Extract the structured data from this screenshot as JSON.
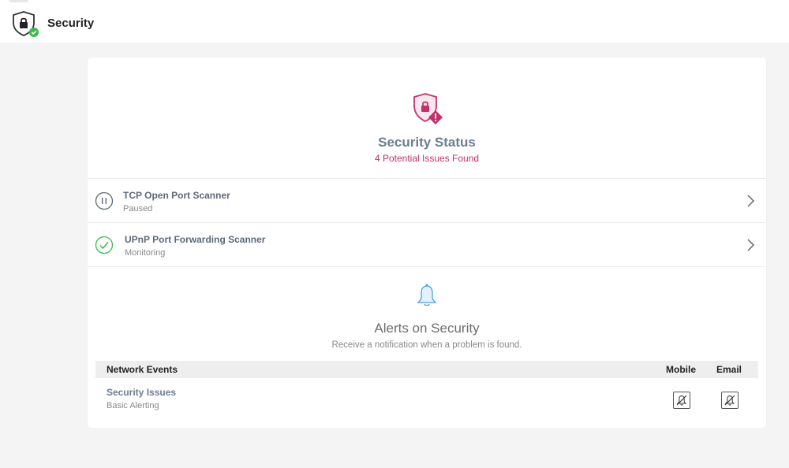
{
  "header": {
    "title": "Security",
    "icon": "shield-lock-icon",
    "badge_icon": "check-circle-icon",
    "badge_color": "#3cb94a"
  },
  "status": {
    "icon": "shield-warning-icon",
    "title": "Security Status",
    "subtitle": "4 Potential Issues Found",
    "accent_color": "#c4306b"
  },
  "scanners": [
    {
      "name": "TCP Open Port Scanner",
      "state": "Paused",
      "icon": "pause-circle-icon"
    },
    {
      "name": "UPnP Port Forwarding Scanner",
      "state": "Monitoring",
      "icon": "check-circle-icon",
      "color": "#3cb94a"
    }
  ],
  "alerts": {
    "icon": "bell-icon",
    "title": "Alerts on Security",
    "description": "Receive a notification when a problem is found.",
    "columns": {
      "name": "Network Events",
      "mobile": "Mobile",
      "email": "Email"
    },
    "events": [
      {
        "name": "Security Issues",
        "level": "Basic Alerting",
        "mobile_icon": "bell-off-icon",
        "email_icon": "bell-off-icon"
      }
    ]
  }
}
